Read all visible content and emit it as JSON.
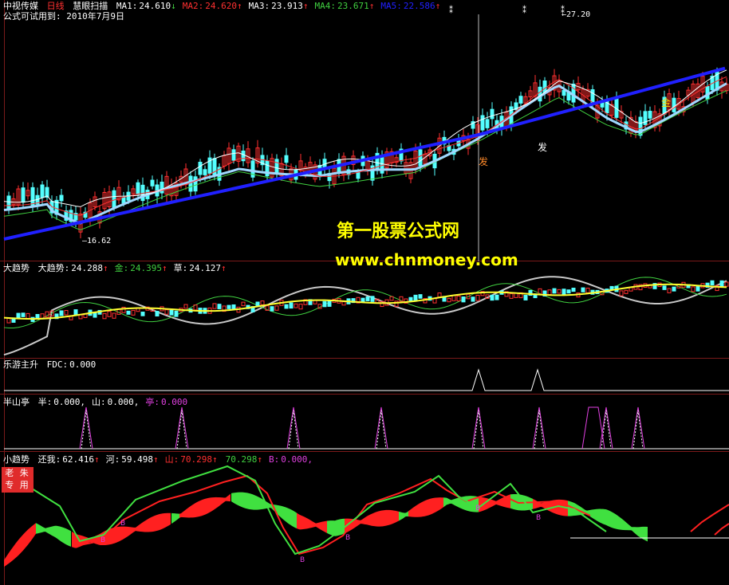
{
  "main": {
    "stock": "中视传媒",
    "period": "日线",
    "tool": "慧眼扫描",
    "ma": [
      {
        "label": "MA1:",
        "value": "24.610",
        "arrow": "↓",
        "color": "#ffffff"
      },
      {
        "label": "MA2:",
        "value": "24.620",
        "arrow": "↑",
        "color": "#ff3030"
      },
      {
        "label": "MA3:",
        "value": "23.913",
        "arrow": "↑",
        "color": "#ffffff"
      },
      {
        "label": "MA4:",
        "value": "23.671",
        "arrow": "↑",
        "color": "#40d040"
      },
      {
        "label": "MA5:",
        "value": "22.586",
        "arrow": "↑",
        "color": "#2020ff"
      }
    ],
    "trial_note": "公式可试用到: 2010年7月9日",
    "high_label": "27.20",
    "low_label": "16.62",
    "signals": [
      "发",
      "发",
      "金"
    ]
  },
  "watermark": {
    "line1": "第一股票公式网",
    "line2": "www.chnmoney.com"
  },
  "panel2": {
    "title": "大趋势",
    "items": [
      {
        "label": "大趋势:",
        "value": "24.288",
        "arrow": "↑",
        "color": "#ffffff"
      },
      {
        "label": "金:",
        "value": "24.395",
        "arrow": "↑",
        "color": "#40d040"
      },
      {
        "label": "草:",
        "value": "24.127",
        "arrow": "↑",
        "color": "#ffffff"
      }
    ]
  },
  "panel3": {
    "title": "乐游主升",
    "items": [
      {
        "label": "FDC:",
        "value": "0.000",
        "arrow": "",
        "color": "#ffffff"
      }
    ]
  },
  "panel4": {
    "title": "半山亭",
    "items": [
      {
        "label": "半:",
        "value": "0.000,",
        "arrow": "",
        "color": "#ffffff"
      },
      {
        "label": "山:",
        "value": "0.000,",
        "arrow": "",
        "color": "#ffffff"
      },
      {
        "label": "亭:",
        "value": "0.000",
        "arrow": "",
        "color": "#e040e0"
      }
    ]
  },
  "panel5": {
    "title": "小趋势",
    "items": [
      {
        "label": "还我:",
        "value": "62.416",
        "arrow": "↑",
        "color": "#ffffff"
      },
      {
        "label": "河:",
        "value": "59.498",
        "arrow": "↑",
        "color": "#ffffff"
      },
      {
        "label": "山:",
        "value": "70.298",
        "arrow": "↑",
        "color": "#ff3030"
      },
      {
        "label": "",
        "value": "70.298",
        "arrow": "↑",
        "color": "#40d040"
      },
      {
        "label": "B:",
        "value": "0.000,",
        "arrow": "",
        "color": "#e040e0"
      }
    ],
    "badge": "老 朱 专 用",
    "b_marker": "B"
  }
}
